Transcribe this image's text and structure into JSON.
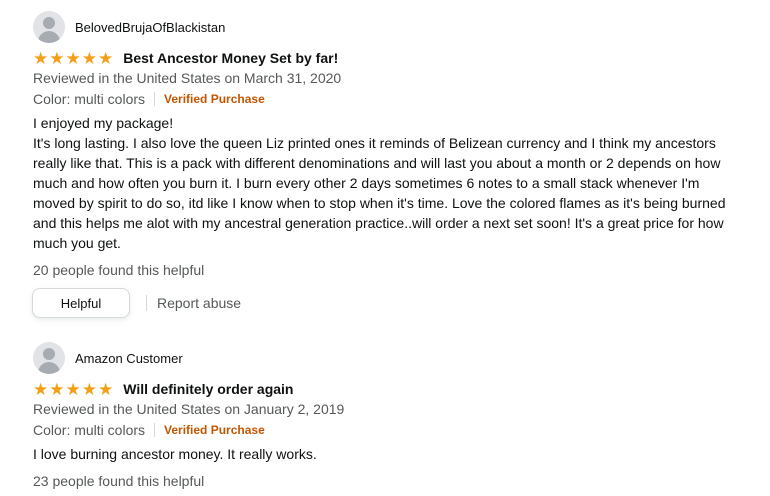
{
  "reviews": [
    {
      "author": "BelovedBrujaOfBlackistan",
      "rating": 5,
      "stars": [
        "★",
        "★",
        "★",
        "★",
        "★"
      ],
      "title": "Best Ancestor Money Set by far!",
      "reviewed_in": "Reviewed in the United States on March 31, 2020",
      "variant": "Color: multi colors",
      "verified": "Verified Purchase",
      "body_lines": [
        "I enjoyed my package!",
        "It's long lasting. I also love the queen Liz printed ones it reminds of Belizean currency and I think my ancestors really like that. This is a pack with different denominations and will last you about a month or 2 depends on how much and how often you burn it. I burn every other 2 days sometimes 6 notes to a small stack whenever I'm moved by spirit to do so, itd like I know when to stop when it's time. Love the colored flames as it's being burned and this helps me alot with my ancestral generation practice..will order a next set soon! It's a great price for how much you get."
      ],
      "helpful_count": "20 people found this helpful",
      "helpful_label": "Helpful",
      "report_label": "Report abuse"
    },
    {
      "author": "Amazon Customer",
      "rating": 5,
      "stars": [
        "★",
        "★",
        "★",
        "★",
        "★"
      ],
      "title": "Will definitely order again",
      "reviewed_in": "Reviewed in the United States on January 2, 2019",
      "variant": "Color: multi colors",
      "verified": "Verified Purchase",
      "body_lines": [
        "I love burning ancestor money. It really works."
      ],
      "helpful_count": "23 people found this helpful"
    }
  ],
  "colors": {
    "star": "#f49f17",
    "verified": "#c45500",
    "meta": "#565959",
    "text": "#0f1111"
  },
  "icons": {
    "avatar": "default-avatar-icon",
    "star": "star-icon"
  }
}
